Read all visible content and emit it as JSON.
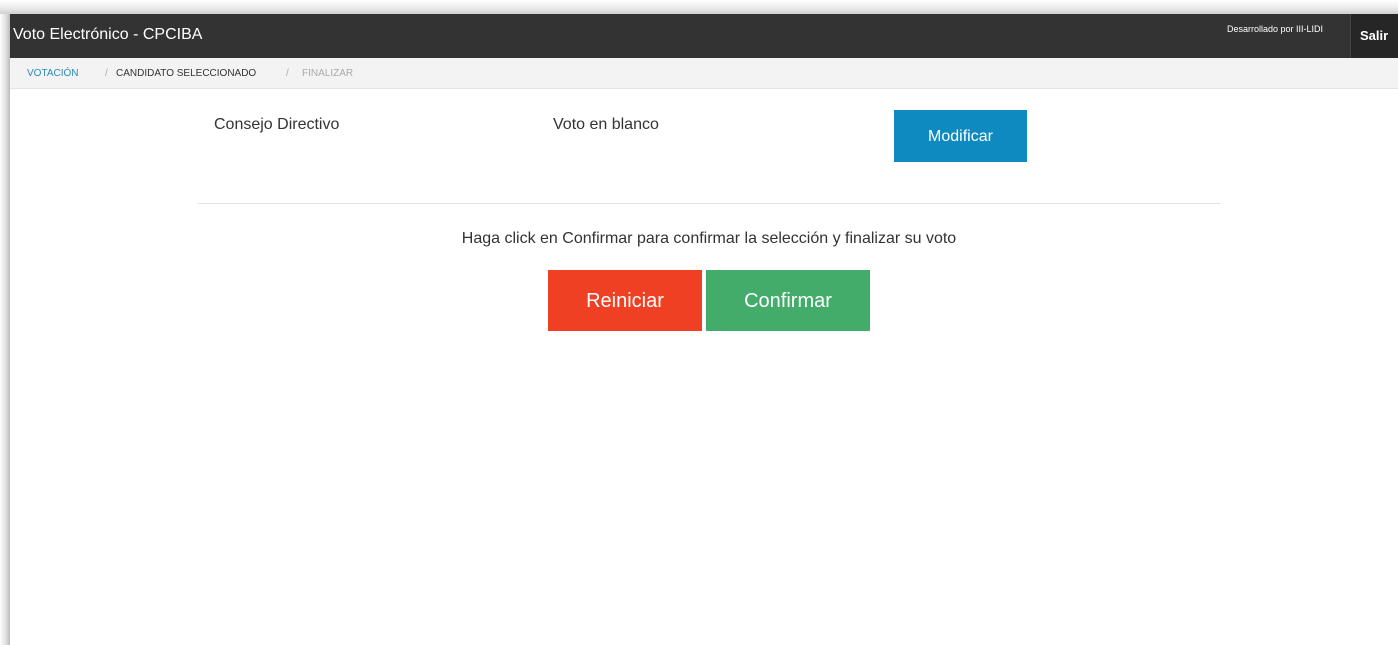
{
  "navbar": {
    "title": "Voto Electrónico - CPCIBA",
    "credit": "Desarrollado por III-LIDI",
    "logout_label": "Salir"
  },
  "breadcrumb": {
    "items": [
      {
        "label": "VOTACIÓN"
      },
      {
        "label": "CANDIDATO SELECCIONADO"
      },
      {
        "label": "FINALIZAR"
      }
    ],
    "separator": "/"
  },
  "selection": {
    "cargo": "Consejo Directivo",
    "choice": "Voto en blanco",
    "modify_label": "Modificar"
  },
  "confirmation": {
    "instruction": "Haga click en Confirmar para confirmar la selección y finalizar su voto",
    "reset_label": "Reiniciar",
    "confirm_label": "Confirmar"
  },
  "colors": {
    "navbar_bg": "#333333",
    "link_blue": "#2a8ab8",
    "modify_blue": "#0e8ac0",
    "reset_red": "#ef4024",
    "confirm_green": "#43ac6a"
  }
}
